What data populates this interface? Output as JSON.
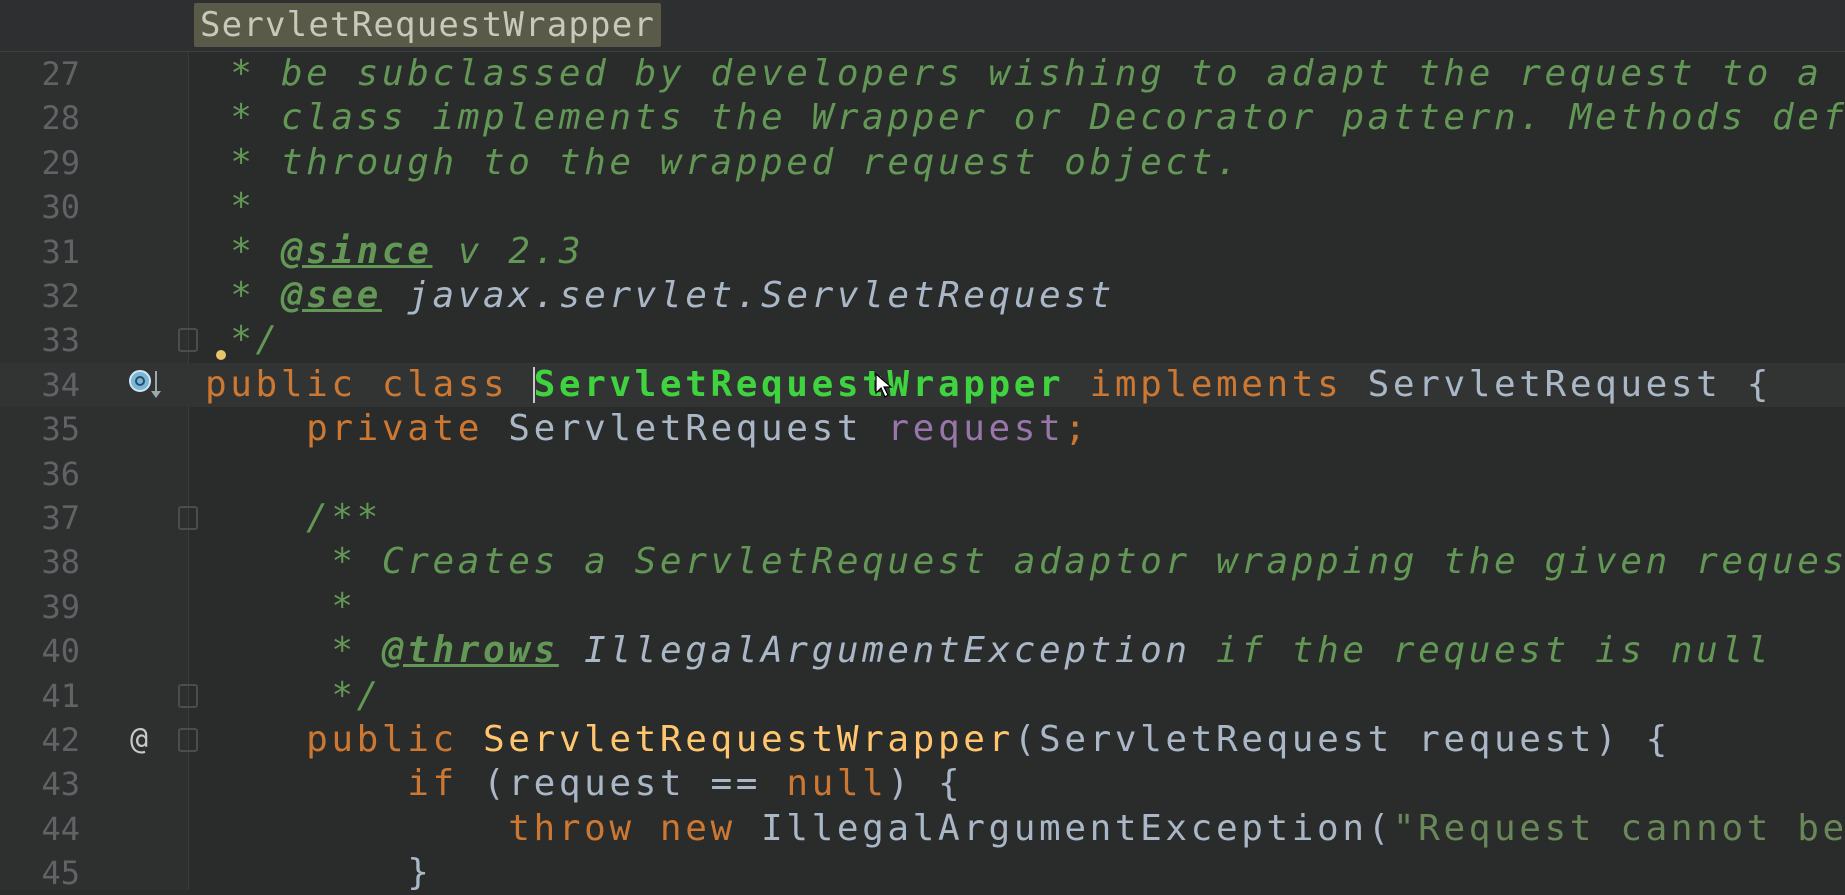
{
  "breadcrumb": "ServletRequestWrapper",
  "colors": {
    "comment": "#629755",
    "keyword": "#cc7832",
    "class": "#3fd33f",
    "method": "#ffc66d",
    "field": "#9876aa",
    "text": "#a9b7c6",
    "string": "#6a8759"
  },
  "current_line": 34,
  "lines": [
    {
      "num": "27",
      "tokens": [
        {
          "t": " * be subclassed by developers wishing to adapt the request to a ",
          "c": "comment"
        }
      ]
    },
    {
      "num": "28",
      "tokens": [
        {
          "t": " * class implements the Wrapper or Decorator pattern. Methods def",
          "c": "comment"
        }
      ]
    },
    {
      "num": "29",
      "tokens": [
        {
          "t": " * through to the wrapped request object.",
          "c": "comment"
        }
      ]
    },
    {
      "num": "30",
      "tokens": [
        {
          "t": " *",
          "c": "comment"
        }
      ]
    },
    {
      "num": "31",
      "tokens": [
        {
          "t": " * ",
          "c": "comment"
        },
        {
          "t": "@since",
          "c": "tag"
        },
        {
          "t": " v 2.3",
          "c": "comment"
        }
      ]
    },
    {
      "num": "32",
      "tokens": [
        {
          "t": " * ",
          "c": "comment"
        },
        {
          "t": "@see",
          "c": "tag"
        },
        {
          "t": " javax.servlet.ServletRequest",
          "c": "ref"
        }
      ]
    },
    {
      "num": "33",
      "tokens": [
        {
          "t": " */",
          "c": "comment"
        }
      ]
    },
    {
      "num": "34",
      "tokens": [
        {
          "t": "public class ",
          "c": "kw"
        },
        {
          "t": "ServletRequestWrapper",
          "c": "cls"
        },
        {
          "t": " implements ",
          "c": "kw"
        },
        {
          "t": "ServletRequest {",
          "c": "plain"
        }
      ]
    },
    {
      "num": "35",
      "tokens": [
        {
          "t": "    private ",
          "c": "kw"
        },
        {
          "t": "ServletRequest ",
          "c": "plain"
        },
        {
          "t": "request",
          "c": "field"
        },
        {
          "t": ";",
          "c": "kw"
        }
      ]
    },
    {
      "num": "36",
      "tokens": []
    },
    {
      "num": "37",
      "tokens": [
        {
          "t": "    /**",
          "c": "comment"
        }
      ]
    },
    {
      "num": "38",
      "tokens": [
        {
          "t": "     * Creates a ServletRequest adaptor wrapping the given reques",
          "c": "comment"
        }
      ]
    },
    {
      "num": "39",
      "tokens": [
        {
          "t": "     *",
          "c": "comment"
        }
      ]
    },
    {
      "num": "40",
      "tokens": [
        {
          "t": "     * ",
          "c": "comment"
        },
        {
          "t": "@throws",
          "c": "tag"
        },
        {
          "t": " IllegalArgumentException",
          "c": "ref"
        },
        {
          "t": " if the request is null",
          "c": "comment"
        }
      ]
    },
    {
      "num": "41",
      "tokens": [
        {
          "t": "     */",
          "c": "comment"
        }
      ]
    },
    {
      "num": "42",
      "tokens": [
        {
          "t": "    public ",
          "c": "kw"
        },
        {
          "t": "ServletRequestWrapper",
          "c": "method"
        },
        {
          "t": "(ServletRequest request) {",
          "c": "plain"
        }
      ]
    },
    {
      "num": "43",
      "tokens": [
        {
          "t": "        if ",
          "c": "kw"
        },
        {
          "t": "(request == ",
          "c": "plain"
        },
        {
          "t": "null",
          "c": "kw"
        },
        {
          "t": ") {",
          "c": "plain"
        }
      ]
    },
    {
      "num": "44",
      "tokens": [
        {
          "t": "            throw new ",
          "c": "kw"
        },
        {
          "t": "IllegalArgumentException(",
          "c": "plain"
        },
        {
          "t": "\"Request cannot be",
          "c": "str"
        }
      ]
    },
    {
      "num": "45",
      "tokens": [
        {
          "t": "        }",
          "c": "plain"
        }
      ]
    }
  ],
  "gutter_icons": {
    "34": "implements-interface-icon",
    "42": "override-annotation-icon"
  },
  "override_glyph": "@"
}
